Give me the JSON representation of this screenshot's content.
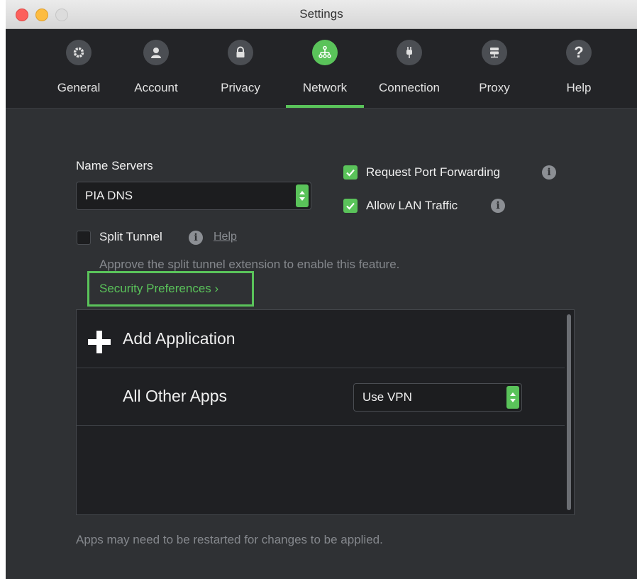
{
  "window": {
    "title": "Settings"
  },
  "tabs": [
    {
      "label": "General",
      "icon": "gear-icon"
    },
    {
      "label": "Account",
      "icon": "person-icon"
    },
    {
      "label": "Privacy",
      "icon": "lock-icon"
    },
    {
      "label": "Network",
      "icon": "network-icon",
      "active": true
    },
    {
      "label": "Connection",
      "icon": "plug-icon"
    },
    {
      "label": "Proxy",
      "icon": "server-icon"
    },
    {
      "label": "Help",
      "icon": "question-icon"
    }
  ],
  "network": {
    "name_servers_label": "Name Servers",
    "name_servers_value": "PIA DNS",
    "request_port_forwarding_label": "Request Port Forwarding",
    "request_port_forwarding_checked": true,
    "allow_lan_label": "Allow LAN Traffic",
    "allow_lan_checked": true,
    "split_tunnel_label": "Split Tunnel",
    "split_tunnel_checked": false,
    "help_link": "Help",
    "approve_hint": "Approve the split tunnel extension to enable this feature.",
    "security_preferences_link": "Security Preferences ›",
    "add_application_label": "Add Application",
    "all_other_apps_label": "All Other Apps",
    "all_other_apps_value": "Use VPN",
    "footer_note": "Apps may need to be restarted for changes to be applied."
  },
  "colors": {
    "accent": "#5ac35a",
    "background": "#2f3134",
    "toolbar": "#232427"
  }
}
